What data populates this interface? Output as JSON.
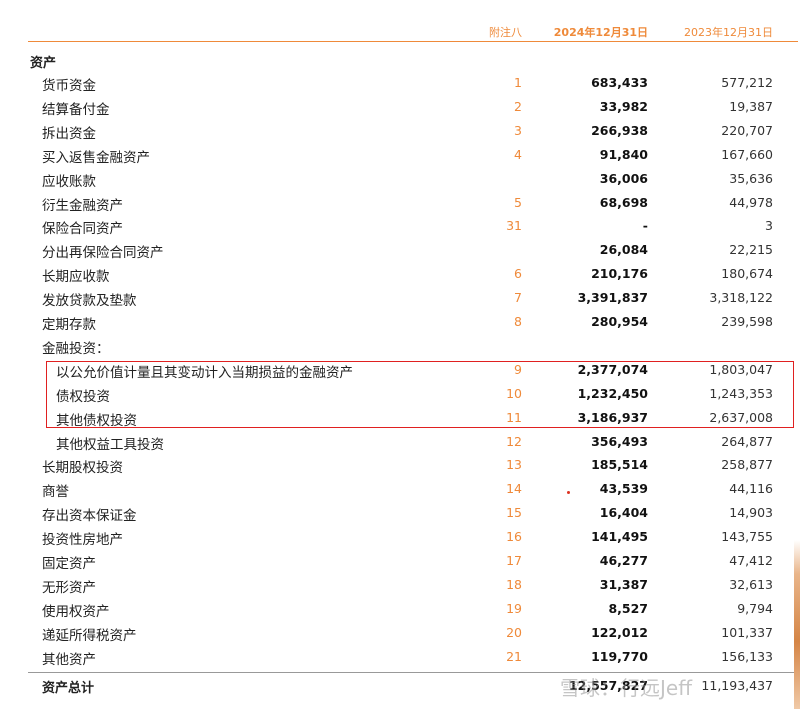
{
  "header": {
    "note_col": "附注八",
    "col_2024": "2024年12月31日",
    "col_2023": "2023年12月31日"
  },
  "section_title": "资产",
  "rows": [
    {
      "label": "货币资金",
      "note": "1",
      "v2024": "683,433",
      "v2023": "577,212"
    },
    {
      "label": "结算备付金",
      "note": "2",
      "v2024": "33,982",
      "v2023": "19,387"
    },
    {
      "label": "拆出资金",
      "note": "3",
      "v2024": "266,938",
      "v2023": "220,707"
    },
    {
      "label": "买入返售金融资产",
      "note": "4",
      "v2024": "91,840",
      "v2023": "167,660"
    },
    {
      "label": "应收账款",
      "note": "",
      "v2024": "36,006",
      "v2023": "35,636"
    },
    {
      "label": "衍生金融资产",
      "note": "5",
      "v2024": "68,698",
      "v2023": "44,978"
    },
    {
      "label": "保险合同资产",
      "note": "31",
      "v2024": "-",
      "v2023": "3"
    },
    {
      "label": "分出再保险合同资产",
      "note": "",
      "v2024": "26,084",
      "v2023": "22,215"
    },
    {
      "label": "长期应收款",
      "note": "6",
      "v2024": "210,176",
      "v2023": "180,674"
    },
    {
      "label": "发放贷款及垫款",
      "note": "7",
      "v2024": "3,391,837",
      "v2023": "3,318,122"
    },
    {
      "label": "定期存款",
      "note": "8",
      "v2024": "280,954",
      "v2023": "239,598"
    },
    {
      "label": "金融投资：",
      "note": "",
      "v2024": "",
      "v2023": ""
    },
    {
      "label": "以公允价值计量且其变动计入当期损益的金融资产",
      "note": "9",
      "v2024": "2,377,074",
      "v2023": "1,803,047"
    },
    {
      "label": "债权投资",
      "note": "10",
      "v2024": "1,232,450",
      "v2023": "1,243,353"
    },
    {
      "label": "其他债权投资",
      "note": "11",
      "v2024": "3,186,937",
      "v2023": "2,637,008"
    },
    {
      "label": "其他权益工具投资",
      "note": "12",
      "v2024": "356,493",
      "v2023": "264,877"
    },
    {
      "label": "长期股权投资",
      "note": "13",
      "v2024": "185,514",
      "v2023": "258,877"
    },
    {
      "label": "商誉",
      "note": "14",
      "v2024": "43,539",
      "v2023": "44,116"
    },
    {
      "label": "存出资本保证金",
      "note": "15",
      "v2024": "16,404",
      "v2023": "14,903"
    },
    {
      "label": "投资性房地产",
      "note": "16",
      "v2024": "141,495",
      "v2023": "143,755"
    },
    {
      "label": "固定资产",
      "note": "17",
      "v2024": "46,277",
      "v2023": "47,412"
    },
    {
      "label": "无形资产",
      "note": "18",
      "v2024": "31,387",
      "v2023": "32,613"
    },
    {
      "label": "使用权资产",
      "note": "19",
      "v2024": "8,527",
      "v2023": "9,794"
    },
    {
      "label": "递延所得税资产",
      "note": "20",
      "v2024": "122,012",
      "v2023": "101,337"
    },
    {
      "label": "其他资产",
      "note": "21",
      "v2024": "119,770",
      "v2023": "156,133"
    }
  ],
  "total": {
    "label": "资产总计",
    "v2024": "12,557,827",
    "v2023": "11,193,437"
  },
  "watermark": "雪球：行远Jeff",
  "colors": {
    "accent": "#ef8a3a",
    "highlight_box": "#e02020"
  }
}
